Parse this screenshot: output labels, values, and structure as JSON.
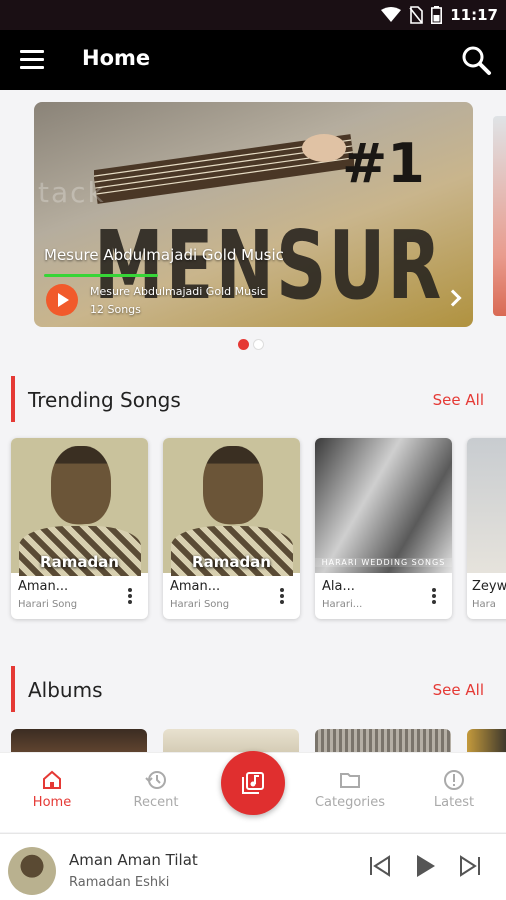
{
  "status_bar": {
    "time": "11:17"
  },
  "app_bar": {
    "title": "Home"
  },
  "banner": {
    "title": "Mesure Abdulmajadi Gold Music",
    "subtitle": "Mesure Abdulmajadi Gold Music",
    "song_count": "12 Songs",
    "artwork_text": "MENSUR",
    "artwork_number": "#1",
    "progress": 0.35,
    "page_count": 2,
    "active_page": 1
  },
  "trending": {
    "title": "Trending Songs",
    "see_all": "See All",
    "items": [
      {
        "title": "Aman...",
        "subtitle": "Harari Song",
        "artwork_caption": "Ramadan"
      },
      {
        "title": "Aman...",
        "subtitle": "Harari Song",
        "artwork_caption": "Ramadan"
      },
      {
        "title": "Ala...",
        "subtitle": "Harari...",
        "artwork_caption": "HARARI WEDDING SONGS"
      },
      {
        "title": "Zeyw",
        "subtitle": "Hara"
      }
    ]
  },
  "albums": {
    "title": "Albums",
    "see_all": "See All"
  },
  "bottom_nav": {
    "items": [
      {
        "label": "Home",
        "icon": "home-icon",
        "active": true
      },
      {
        "label": "Recent",
        "icon": "history-icon",
        "active": false
      },
      {
        "label": "Categories",
        "icon": "folder-icon",
        "active": false
      },
      {
        "label": "Latest",
        "icon": "alert-circle-icon",
        "active": false
      }
    ],
    "center_icon": "music-library-icon"
  },
  "player": {
    "title": "Aman Aman Tilat",
    "artist": "Ramadan Eshki"
  },
  "colors": {
    "accent": "#e53935",
    "app_bar": "#000000",
    "progress": "#37d537",
    "play": "#f15a2b"
  }
}
